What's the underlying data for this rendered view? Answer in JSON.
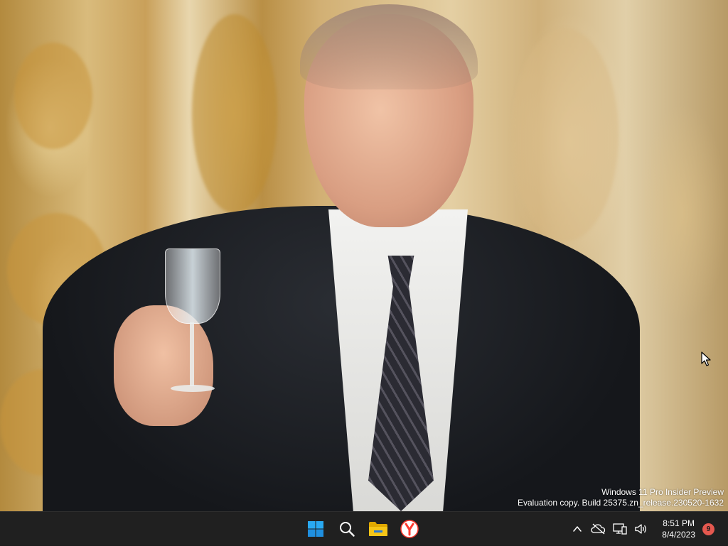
{
  "wallpaper": {
    "description_icon": "photo-wallpaper"
  },
  "watermark": {
    "line1": "Windows 11 Pro Insider Preview",
    "line2": "Evaluation copy. Build 25375.zn_release.230520-1632"
  },
  "taskbar": {
    "pinned": [
      {
        "name": "start",
        "icon": "windows-logo-icon",
        "color": "#29a9f2"
      },
      {
        "name": "search",
        "icon": "search-icon",
        "color": "#ffffff"
      },
      {
        "name": "file-explorer",
        "icon": "folder-icon",
        "color": "#f5c518"
      },
      {
        "name": "yandex-browser",
        "icon": "yandex-browser-icon",
        "color": "#ff3b30"
      }
    ],
    "tray": {
      "icons": [
        "chevron-up-icon",
        "cloud-offline-icon",
        "network-icon",
        "volume-icon"
      ],
      "time": "8:51 PM",
      "date": "8/4/2023",
      "notification_count": "9",
      "notification_color": "#e5584f"
    }
  }
}
